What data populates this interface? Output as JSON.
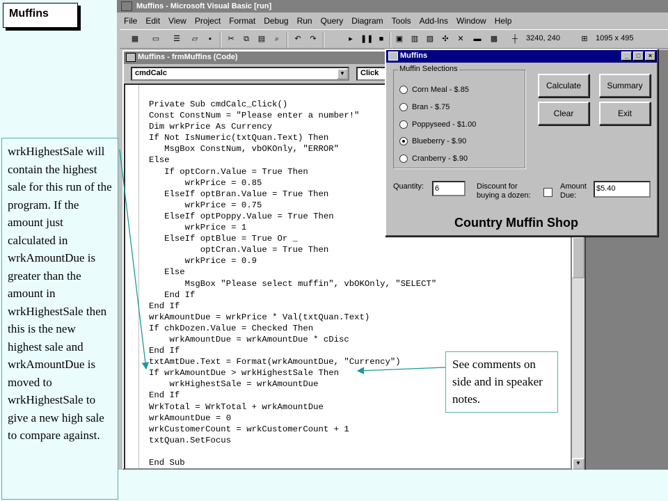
{
  "slide": {
    "title": "Muffins",
    "side_note": "wrkHighestSale will contain the highest sale for this run of the program.  If the amount just calculated in wrkAmountDue is greater than the amount in wrkHighestSale then this is the new highest sale and wrkAmountDue is moved to wrkHighestSale to give a new high sale to compare against.",
    "callout": "See comments on side and in speaker notes."
  },
  "vb": {
    "title": "Muffins - Microsoft Visual Basic [run]",
    "menu": [
      "File",
      "Edit",
      "View",
      "Project",
      "Format",
      "Debug",
      "Run",
      "Query",
      "Diagram",
      "Tools",
      "Add-Ins",
      "Window",
      "Help"
    ],
    "position": "3240, 240",
    "size": "1095 x 495"
  },
  "code_window": {
    "title": "Muffins - frmMuffins (Code)",
    "object": "cmdCalc",
    "procedure": "Click",
    "lines": [
      "Private Sub cmdCalc_Click()",
      "Const ConstNum = \"Please enter a number!\"",
      "Dim wrkPrice As Currency",
      "If Not IsNumeric(txtQuan.Text) Then",
      "   MsgBox ConstNum, vbOKOnly, \"ERROR\"",
      "Else",
      "   If optCorn.Value = True Then",
      "       wrkPrice = 0.85",
      "   ElseIf optBran.Value = True Then",
      "       wrkPrice = 0.75",
      "   ElseIf optPoppy.Value = True Then",
      "       wrkPrice = 1",
      "   ElseIf optBlue = True Or _",
      "          optCran.Value = True Then",
      "       wrkPrice = 0.9",
      "   Else",
      "       MsgBox \"Please select muffin\", vbOKOnly, \"SELECT\"",
      "   End If",
      "End If",
      "wrkAmountDue = wrkPrice * Val(txtQuan.Text)",
      "If chkDozen.Value = Checked Then",
      "    wrkAmountDue = wrkAmountDue * cDisc",
      "End If",
      "txtAmtDue.Text = Format(wrkAmountDue, \"Currency\")",
      "If wrkAmountDue > wrkHighestSale Then",
      "    wrkHighestSale = wrkAmountDue",
      "End If",
      "WrkTotal = WrkTotal + wrkAmountDue",
      "wrkAmountDue = 0",
      "wrkCustomerCount = wrkCustomerCount + 1",
      "txtQuan.SetFocus",
      "",
      "End Sub"
    ]
  },
  "form": {
    "title": "Muffins",
    "frame_label": "Muffin Selections",
    "options": [
      {
        "label": "Corn Meal - $.85",
        "selected": false
      },
      {
        "label": "Bran - $.75",
        "selected": false
      },
      {
        "label": "Poppyseed - $1.00",
        "selected": false
      },
      {
        "label": "Blueberry - $.90",
        "selected": true
      },
      {
        "label": "Cranberry - $.90",
        "selected": false
      }
    ],
    "buttons": {
      "calculate": "Calculate",
      "summary": "Summary",
      "clear": "Clear",
      "exit": "Exit"
    },
    "quantity_label": "Quantity:",
    "quantity_value": "6",
    "discount_label": "Discount for buying a dozen:",
    "amount_label": "Amount Due:",
    "amount_value": "$5.40",
    "shop_name": "Country Muffin Shop"
  }
}
